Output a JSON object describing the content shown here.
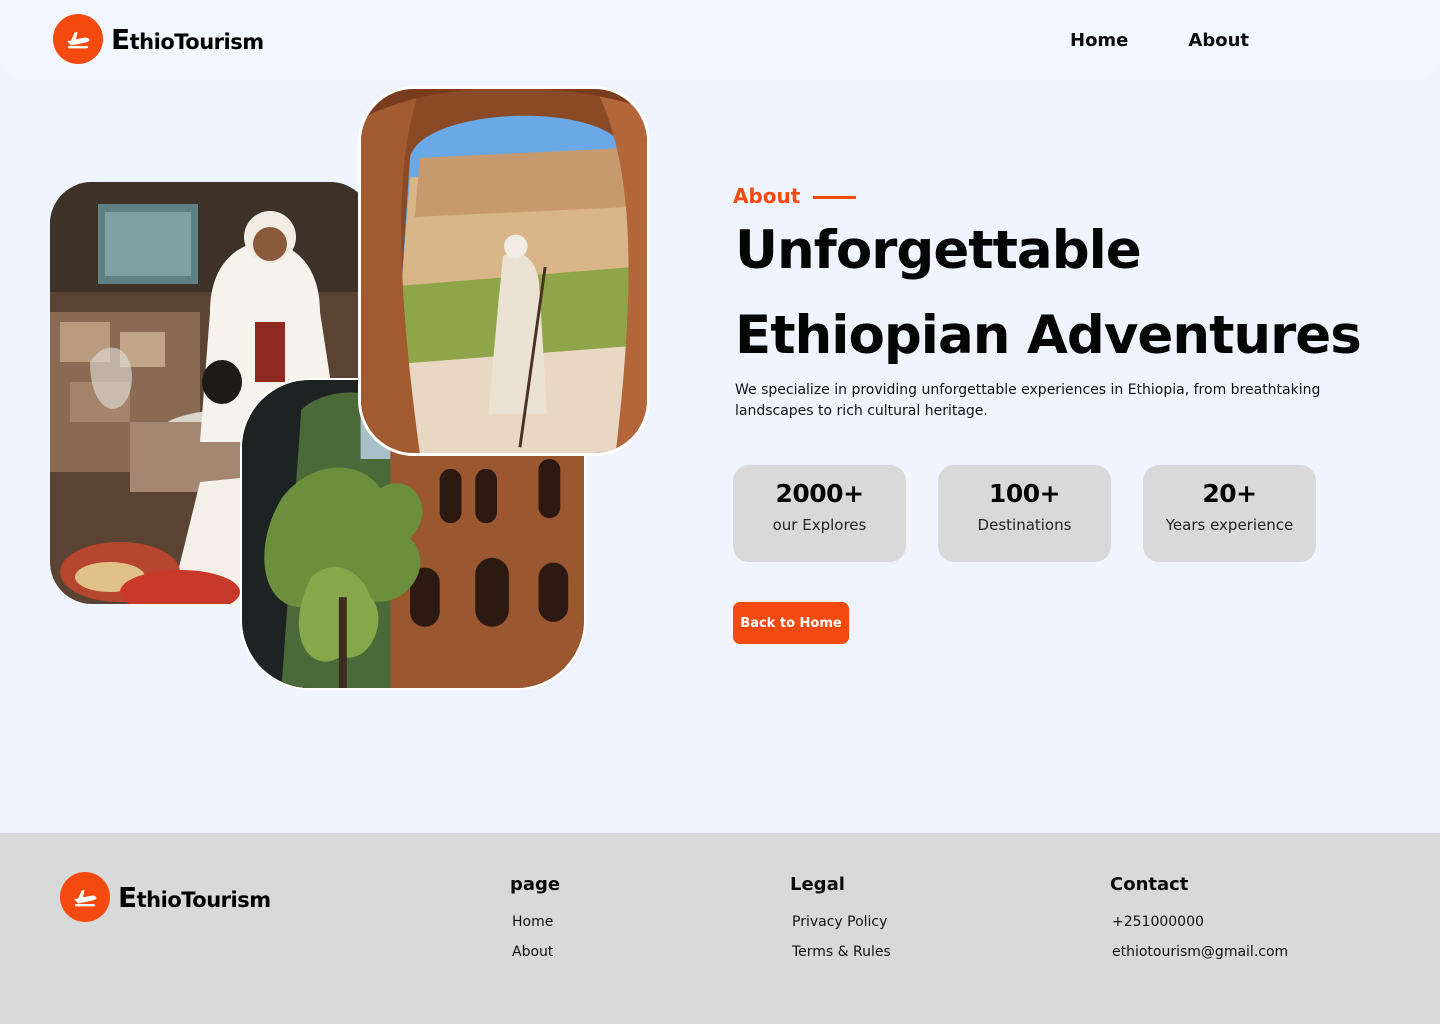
{
  "brand": {
    "name_initial": "E",
    "name_rest": "thioTourism",
    "accent_color": "#f54a0f",
    "logo_icon": "airplane-icon"
  },
  "nav": {
    "items": [
      {
        "label": "Home"
      },
      {
        "label": "About"
      }
    ]
  },
  "hero": {
    "eyebrow": "About",
    "title_line1": "Unforgettable",
    "title_line2": "Ethiopian Adventures",
    "description": "We specialize in providing unforgettable experiences in Ethiopia, from breathtaking landscapes to rich cultural heritage.",
    "stats": [
      {
        "value": "2000+",
        "label": "our Explores"
      },
      {
        "value": "100+",
        "label": "Destinations"
      },
      {
        "value": "20+",
        "label": "Years experience"
      }
    ],
    "cta_label": "Back to Home"
  },
  "footer": {
    "page": {
      "heading": "page",
      "links": [
        {
          "label": "Home"
        },
        {
          "label": "About"
        }
      ]
    },
    "legal": {
      "heading": "Legal",
      "links": [
        {
          "label": "Privacy Policy"
        },
        {
          "label": "Terms & Rules"
        }
      ]
    },
    "contact": {
      "heading": "Contact",
      "phone": "+251000000",
      "email": "ethiotourism@gmail.com"
    }
  }
}
